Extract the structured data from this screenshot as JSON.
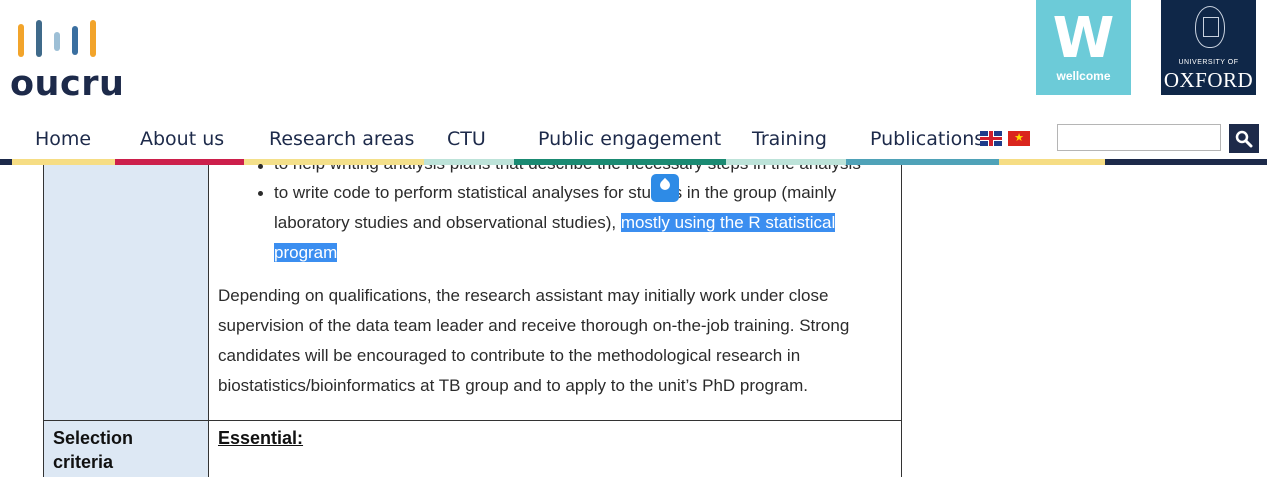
{
  "brand": {
    "logo_text": "oucru",
    "logo_bars": [
      {
        "color": "#f2a42b"
      },
      {
        "color": "#3f6a8a"
      },
      {
        "color": "#9dbfd6"
      },
      {
        "color": "#3a6fa0"
      },
      {
        "color": "#f2a42b"
      }
    ],
    "partner_wellcome_text": "wellcome",
    "partner_wellcome_mark": "W",
    "partner_oxford_small": "UNIVERSITY OF",
    "partner_oxford_large": "OXFORD"
  },
  "nav": {
    "items": [
      {
        "label": "Home",
        "stripe_color": "#f6dd84"
      },
      {
        "label": "About us",
        "stripe_color": "#cc1f4b"
      },
      {
        "label": "Research areas",
        "stripe_color": "#f4e08a"
      },
      {
        "label": "CTU",
        "stripe_color": "#1a8a72"
      },
      {
        "label": "Public engagement",
        "stripe_color": "#1a8a72"
      },
      {
        "label": "Training",
        "stripe_color": "#bde3d9"
      },
      {
        "label": "Publications",
        "stripe_color": "#4fa2b8"
      }
    ],
    "flags": [
      {
        "name": "uk-flag-icon"
      },
      {
        "name": "vietnam-flag-icon",
        "glyph": "★"
      }
    ],
    "search": {
      "placeholder": "",
      "value": "",
      "button_icon": "search-icon"
    }
  },
  "content": {
    "partial_line": "to help writing analysis plans that describe the necessary steps in the analysis",
    "bullet2_line1": "to write code to perform statistical analyses for studies in the group (mainly",
    "bullet2_line2_plain": "laboratory studies and observational studies), ",
    "bullet2_line2_highlight": "mostly using the R statistical",
    "bullet2_line3_highlight": "program",
    "paragraph_lines": [
      "Depending on qualifications, the research assistant may initially work under close",
      "supervision of the data team leader and receive thorough on-the-job training. Strong",
      "candidates will be encouraged to contribute to the methodological research in",
      "biostatistics/bioinformatics at TB group and to apply to the unit’s PhD program."
    ],
    "criteria_label_line1": "Selection",
    "criteria_label_line2": "criteria",
    "essential_heading": "Essential:"
  },
  "colors": {
    "highlight": "#3b8ef0",
    "label_column": "#dde8f4",
    "nav_text": "#1d2a4a"
  }
}
